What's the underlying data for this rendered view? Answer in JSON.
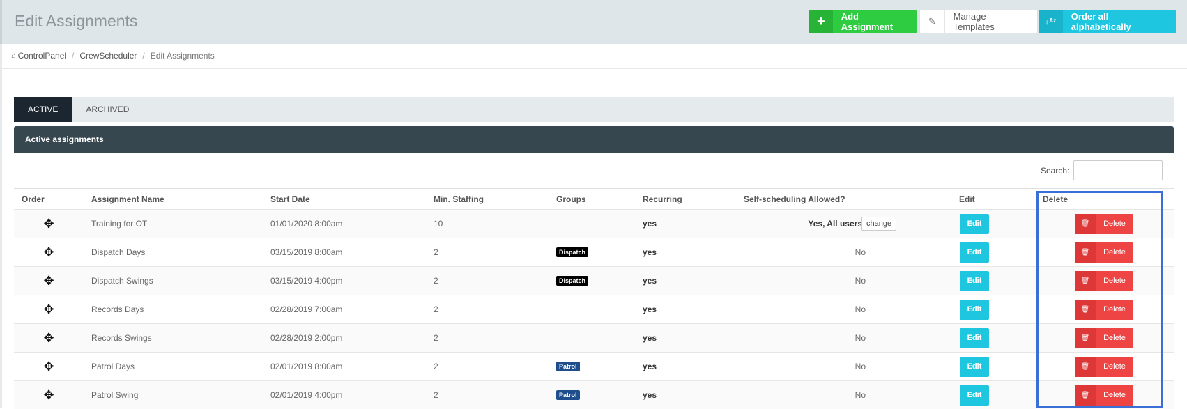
{
  "header": {
    "title": "Edit Assignments",
    "add_assignment": "Add Assignment",
    "manage_templates": "Manage Templates",
    "order_alphabetically": "Order all alphabetically"
  },
  "breadcrumb": {
    "home": "ControlPanel",
    "section": "CrewScheduler",
    "current": "Edit Assignments"
  },
  "tabs": [
    "ACTIVE",
    "ARCHIVED"
  ],
  "panel_title": "Active assignments",
  "search": {
    "label": "Search:",
    "value": ""
  },
  "table": {
    "headers": {
      "order": "Order",
      "name": "Assignment Name",
      "start": "Start Date",
      "staffing": "Min. Staffing",
      "groups": "Groups",
      "recurring": "Recurring",
      "self": "Self-scheduling Allowed?",
      "edit": "Edit",
      "delete": "Delete"
    },
    "rows": [
      {
        "name": "Training for OT",
        "start": "01/01/2020 8:00am",
        "staffing": "10",
        "group": "",
        "recurring": "yes",
        "self": "Yes, All users",
        "change": "change",
        "edit": "Edit",
        "delete": "Delete"
      },
      {
        "name": "Dispatch Days",
        "start": "03/15/2019 8:00am",
        "staffing": "2",
        "group": "Dispatch",
        "recurring": "yes",
        "self": "No",
        "edit": "Edit",
        "delete": "Delete"
      },
      {
        "name": "Dispatch Swings",
        "start": "03/15/2019 4:00pm",
        "staffing": "2",
        "group": "Dispatch",
        "recurring": "yes",
        "self": "No",
        "edit": "Edit",
        "delete": "Delete"
      },
      {
        "name": "Records Days",
        "start": "02/28/2019 7:00am",
        "staffing": "2",
        "group": "",
        "recurring": "yes",
        "self": "No",
        "edit": "Edit",
        "delete": "Delete"
      },
      {
        "name": "Records Swings",
        "start": "02/28/2019 2:00pm",
        "staffing": "2",
        "group": "",
        "recurring": "yes",
        "self": "No",
        "edit": "Edit",
        "delete": "Delete"
      },
      {
        "name": "Patrol Days",
        "start": "02/01/2019 8:00am",
        "staffing": "2",
        "group": "Patrol",
        "recurring": "yes",
        "self": "No",
        "edit": "Edit",
        "delete": "Delete"
      },
      {
        "name": "Patrol Swing",
        "start": "02/01/2019 4:00pm",
        "staffing": "2",
        "group": "Patrol",
        "recurring": "yes",
        "self": "No",
        "edit": "Edit",
        "delete": "Delete"
      }
    ]
  },
  "colors": {
    "add": "#2ecc40",
    "info": "#1ec6e0",
    "danger": "#ee4444",
    "panel": "#37474f",
    "tab_active": "#1b2631",
    "dispatch_tag": "#000000",
    "patrol_tag": "#1e4f8c",
    "highlight": "#3a6fd8"
  },
  "icons": {
    "add": "plus-icon",
    "templates": "edit-icon",
    "order": "sort-alpha-icon",
    "home": "home-icon",
    "drag": "move-icon",
    "delete": "trash-icon"
  }
}
